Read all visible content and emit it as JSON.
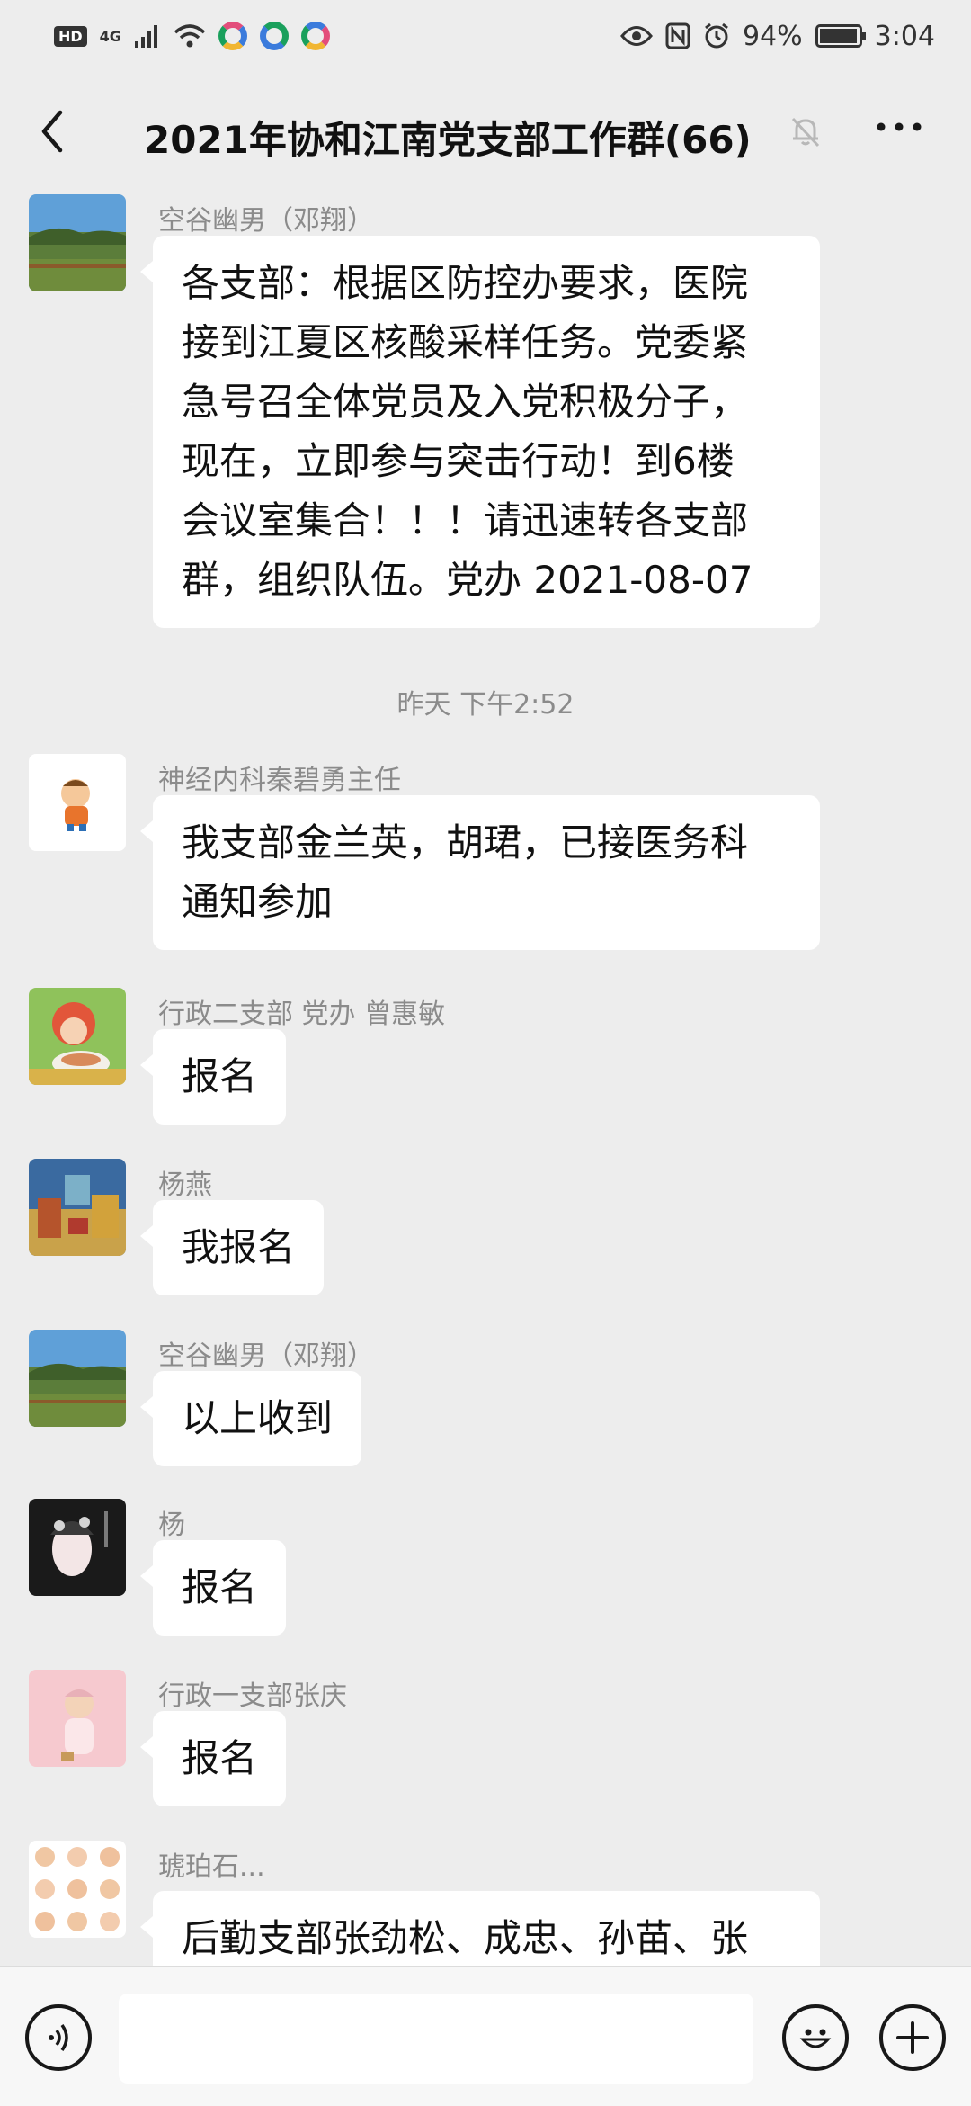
{
  "status_bar": {
    "hd": "HD",
    "network": "4G",
    "battery_text": "94%",
    "time": "3:04",
    "app_colors": [
      "#e34d7b",
      "#1aa05c",
      "#3b7bdc"
    ]
  },
  "header": {
    "title": "2021年协和江南党支部工作群(66)",
    "back_icon": "chevron-left-icon",
    "mute_icon": "bell-off-icon",
    "more_icon": "more-dots-icon"
  },
  "messages": [
    {
      "sender": "空谷幽男（邓翔）",
      "lines": [
        "各支部：根据区防控办要求，医院",
        "接到江夏区核酸采样任务。党委紧",
        "急号召全体党员及入党积极分子，",
        "现在，立即参与突击行动！到6楼",
        "会议室集合！！！请迅速转各支部",
        "群，组织队伍。党办  2021-08-07"
      ]
    },
    {
      "sender": "神经内科秦碧勇主任",
      "lines": [
        "我支部金兰英，胡珺，已接医务科",
        "通知参加"
      ]
    },
    {
      "sender": "行政二支部 党办 曾惠敏",
      "lines": [
        "报名"
      ]
    },
    {
      "sender": "杨燕",
      "lines": [
        "我报名"
      ]
    },
    {
      "sender": "空谷幽男（邓翔）",
      "lines": [
        "以上收到"
      ]
    },
    {
      "sender": "杨",
      "lines": [
        "报名"
      ]
    },
    {
      "sender": "行政一支部张庆",
      "lines": [
        "报名"
      ]
    },
    {
      "sender": "琥珀石...",
      "lines": [
        "后勤支部张劲松、成忠、孙苗、张"
      ]
    }
  ],
  "timestamp": "昨天 下午2:52",
  "input_bar": {
    "voice_icon": "voice-icon",
    "emoji_icon": "emoji-icon",
    "plus_icon": "plus-icon",
    "placeholder": ""
  }
}
